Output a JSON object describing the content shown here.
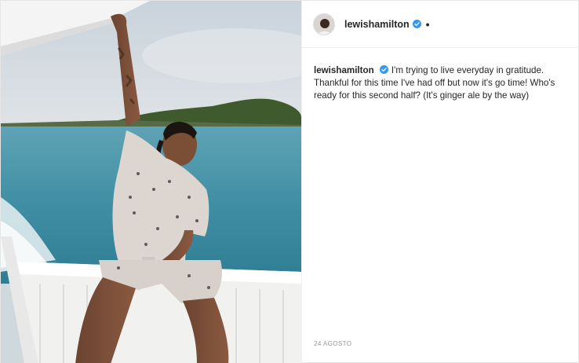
{
  "post": {
    "username": "lewishamilton",
    "verified": true,
    "header_separator": "•",
    "caption": "I'm trying to live everyday in gratitude. Thankful for this time I've had off but now it's go time! Who's ready for this second half? (It's ginger ale by the way)",
    "date": "24 AGOSTO"
  },
  "colors": {
    "verified_badge": "#3897f0",
    "username_text": "#262626",
    "date_text": "#999999",
    "divider": "#efefef"
  }
}
